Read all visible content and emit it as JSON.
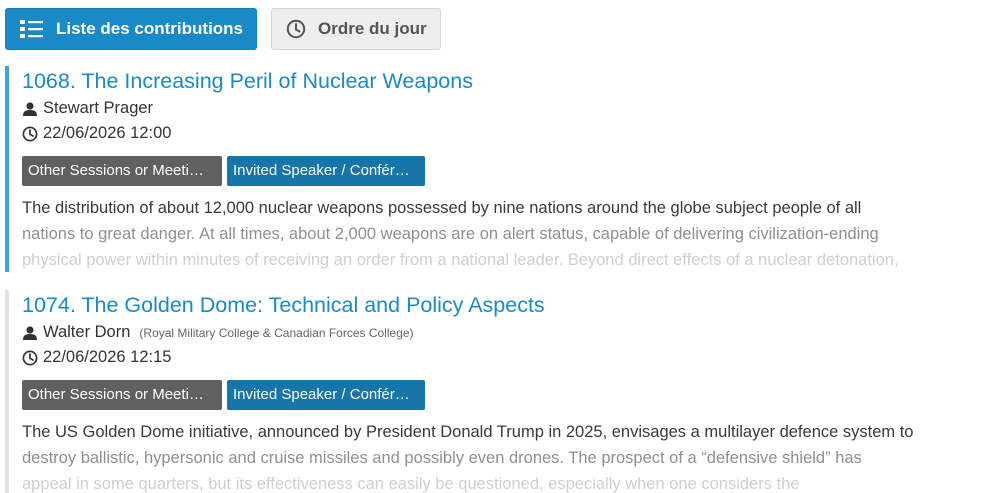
{
  "toolbar": {
    "list_label": "Liste des contributions",
    "agenda_label": "Ordre du jour"
  },
  "contributions": [
    {
      "title": "1068. The Increasing Peril of Nuclear Weapons",
      "speaker": "Stewart Prager",
      "affiliation": "",
      "datetime": "22/06/2026 12:00",
      "tags": [
        "Other Sessions or Meeti…",
        "Invited Speaker / Confér…"
      ],
      "description": [
        "The distribution of about 12,000 nuclear weapons possessed by nine nations around the globe subject people of all",
        "nations to great danger. At all times, about 2,000 weapons are on alert status, capable of delivering civilization-ending",
        "physical power within minutes of receiving an order from a national leader. Beyond direct effects of a nuclear detonation,"
      ]
    },
    {
      "title": "1074. The Golden Dome: Technical and Policy Aspects",
      "speaker": "Walter Dorn",
      "affiliation": "(Royal Military College & Canadian Forces College)",
      "datetime": "22/06/2026 12:15",
      "tags": [
        "Other Sessions or Meeti…",
        "Invited Speaker / Confér…"
      ],
      "description": [
        "The US Golden Dome initiative, announced by President Donald Trump in 2025, envisages a multilayer defence system to",
        "destroy ballistic, hypersonic and cruise missiles and possibly even drones. The prospect of a “defensive shield” has",
        "appeal in some quarters, but its effectiveness can easily be questioned, especially when one considers the"
      ]
    }
  ],
  "icons": {
    "list": "list-icon",
    "clock": "clock-icon",
    "person": "person-icon"
  },
  "colors": {
    "accent": "#1a8ac6",
    "tag_grey": "#606060",
    "tag_blue": "#1775a9",
    "active_bar": "#3fa3d8"
  }
}
